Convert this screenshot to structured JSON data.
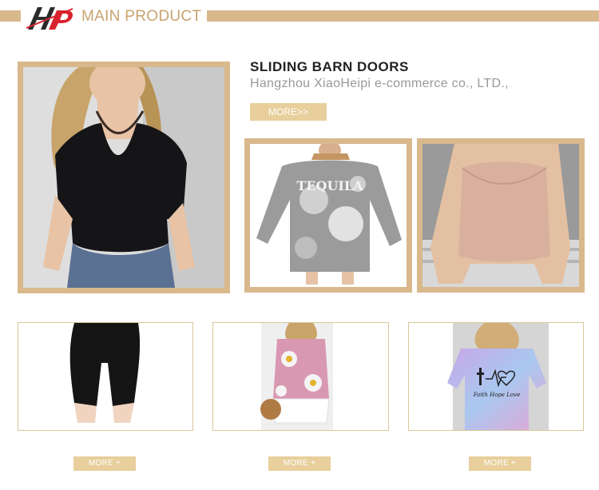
{
  "header": {
    "logo_text": "HP",
    "title": "MAIN PRODUCT"
  },
  "featured": {
    "headline": "SLIDING BARN DOORS",
    "subline": "Hangzhou XiaoHeipi e-commerce co., LTD.,",
    "more_label": "MORE>>"
  },
  "products": [
    {
      "image": "black-v-neck-tshirt-photo"
    },
    {
      "image": "tequila-tie-dye-sweatshirt-photo",
      "print_text": "TEQUILA"
    },
    {
      "image": "nude-crop-top-photo"
    },
    {
      "image": "black-biker-shorts-photo",
      "more_label": "MORE +"
    },
    {
      "image": "pink-floral-tank-dress-photo",
      "more_label": "MORE +"
    },
    {
      "image": "faith-hope-love-tie-dye-tee-photo",
      "print_text": "Faith Hope Love",
      "more_label": "MORE +"
    }
  ],
  "colors": {
    "accent": "#d9b88c",
    "button": "#e8cf9c",
    "logo_red": "#d9232e",
    "logo_dark": "#2b2b2b"
  }
}
